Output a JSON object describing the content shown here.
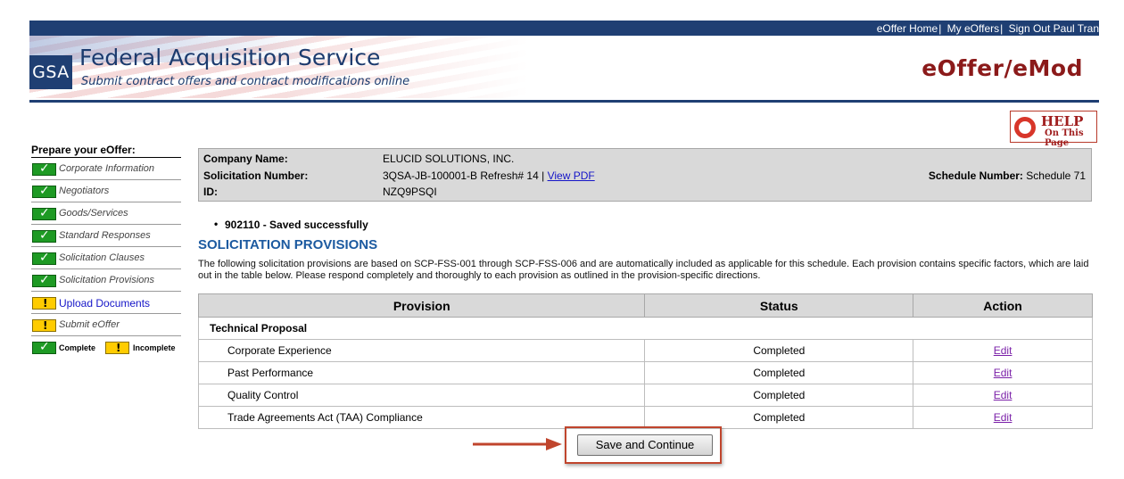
{
  "top_nav": {
    "links": [
      "eOffer Home",
      "My eOffers",
      "Sign Out Paul Tran"
    ]
  },
  "banner": {
    "logo_text": "GSA",
    "title": "Federal Acquisition Service",
    "subtitle": "Submit contract offers and contract modifications online",
    "app_name": "eOffer/eMod"
  },
  "help": {
    "line1": "HELP",
    "line2": "On This Page"
  },
  "sidebar": {
    "title": "Prepare your eOffer:",
    "items": [
      {
        "label": "Corporate Information",
        "status": "complete"
      },
      {
        "label": "Negotiators",
        "status": "complete"
      },
      {
        "label": "Goods/Services",
        "status": "complete"
      },
      {
        "label": "Standard Responses",
        "status": "complete"
      },
      {
        "label": "Solicitation Clauses",
        "status": "complete"
      },
      {
        "label": "Solicitation Provisions",
        "status": "complete"
      },
      {
        "label": "Upload Documents",
        "status": "incomplete"
      },
      {
        "label": "Submit eOffer",
        "status": "incomplete"
      }
    ],
    "legend": {
      "complete": "Complete",
      "incomplete": "Incomplete"
    }
  },
  "info": {
    "company_label": "Company Name:",
    "company_value": "ELUCID SOLUTIONS, INC.",
    "solicitation_label": "Solicitation Number:",
    "solicitation_value": "3QSA-JB-100001-B Refresh# 14 |",
    "view_pdf": "View PDF",
    "id_label": "ID:",
    "id_value": "NZQ9PSQI",
    "schedule_label": "Schedule Number:",
    "schedule_value": "Schedule 71"
  },
  "message": "902110 - Saved successfully",
  "section": {
    "title": "SOLICITATION PROVISIONS",
    "description": "The following solicitation provisions are based on SCP-FSS-001 through SCP-FSS-006 and are automatically included as applicable for this schedule. Each provision contains specific factors, which are laid out in the table below. Please respond completely and thoroughly to each provision as outlined in the provision-specific directions."
  },
  "table": {
    "headers": [
      "Provision",
      "Status",
      "Action"
    ],
    "group": "Technical Proposal",
    "rows": [
      {
        "provision": "Corporate Experience",
        "status": "Completed",
        "action": "Edit"
      },
      {
        "provision": "Past Performance",
        "status": "Completed",
        "action": "Edit"
      },
      {
        "provision": "Quality Control",
        "status": "Completed",
        "action": "Edit"
      },
      {
        "provision": "Trade Agreements Act (TAA) Compliance",
        "status": "Completed",
        "action": "Edit"
      }
    ]
  },
  "save_button": "Save and Continue",
  "colors": {
    "nav_blue": "#1f3f73",
    "app_red": "#8b1a1a",
    "section_blue": "#1c5aa0",
    "annotation_red": "#c0452d"
  }
}
